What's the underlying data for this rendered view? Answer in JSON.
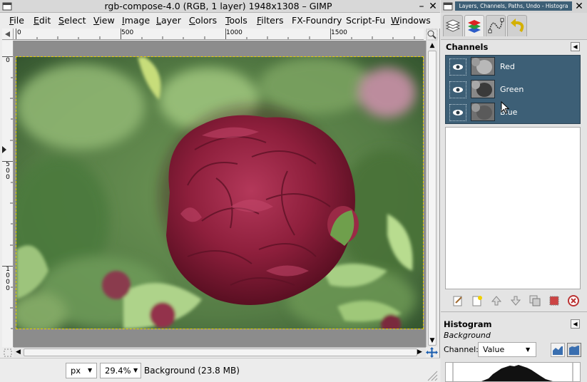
{
  "image_window": {
    "title": "rgb-compose-4.0 (RGB, 1 layer) 1948x1308 – GIMP",
    "minimize_glyph": "–",
    "close_glyph": "✕",
    "menu": [
      {
        "label": "File",
        "underline": "F",
        "rest": "ile"
      },
      {
        "label": "Edit",
        "underline": "E",
        "rest": "dit"
      },
      {
        "label": "Select",
        "underline": "S",
        "rest": "elect"
      },
      {
        "label": "View",
        "underline": "V",
        "rest": "iew"
      },
      {
        "label": "Image",
        "underline": "I",
        "rest": "mage"
      },
      {
        "label": "Layer",
        "underline": "L",
        "rest": "ayer"
      },
      {
        "label": "Colors",
        "underline": "C",
        "rest": "olors"
      },
      {
        "label": "Tools",
        "underline": "T",
        "rest": "ools"
      },
      {
        "label": "Filters",
        "underline": "F",
        "rest": "ilters"
      },
      {
        "label": "FX-Foundry",
        "underline": "",
        "rest": "FX-Foundry"
      },
      {
        "label": "Script-Fu",
        "underline": "",
        "rest": "Script-Fu"
      },
      {
        "label": "Windows",
        "underline": "W",
        "rest": "indows"
      }
    ],
    "ruler_h_labels": [
      "0",
      "500",
      "1000",
      "1500"
    ],
    "ruler_v_labels": [
      "0",
      "500",
      "1000"
    ],
    "status": {
      "unit": "px",
      "zoom": "29.4%",
      "message": "Background (23.8 MB)"
    }
  },
  "dock": {
    "title": "Layers, Channels, Paths, Undo - Histogra",
    "close_glyph": "✕",
    "channels": {
      "title": "Channels",
      "items": [
        {
          "label": "Red"
        },
        {
          "label": "Green"
        },
        {
          "label": "Blue"
        }
      ]
    },
    "histogram": {
      "title": "Histogram",
      "drawable": "Background",
      "channel_label": "Channel:",
      "channel_value": "Value"
    }
  },
  "colors": {
    "selection_blue": "#3d5f76",
    "rose": "#8e1f3c",
    "leaf": "#6c9a56"
  }
}
